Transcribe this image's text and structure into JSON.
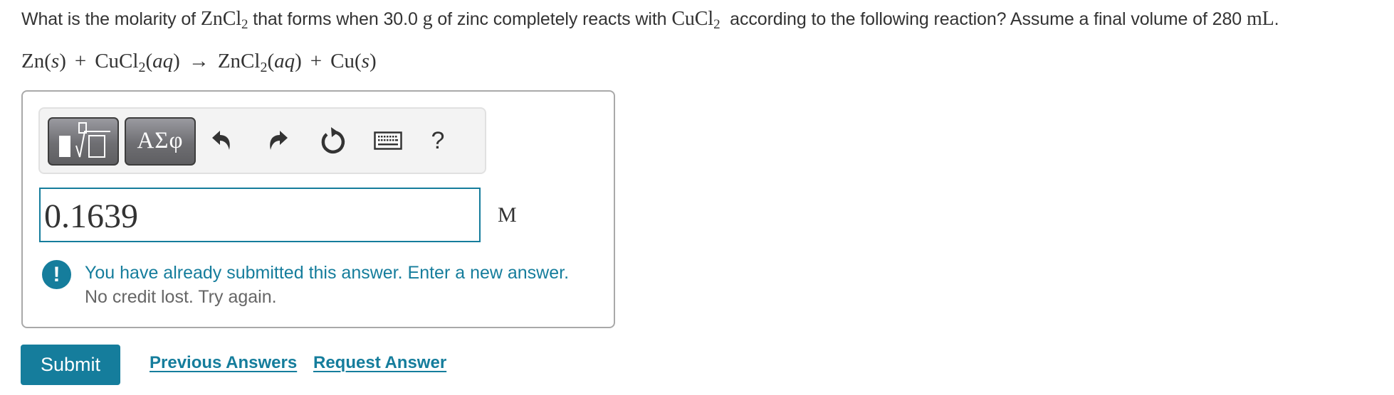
{
  "question": {
    "parts": [
      {
        "type": "text",
        "value": "What is the molarity of "
      },
      {
        "type": "math",
        "base": "ZnCl",
        "sub": "2"
      },
      {
        "type": "text",
        "value": " that forms when 30.0 "
      },
      {
        "type": "math",
        "base": "g",
        "sub": ""
      },
      {
        "type": "text",
        "value": " of zinc completely reacts with "
      },
      {
        "type": "math",
        "base": "CuCl",
        "sub": "2"
      },
      {
        "type": "text",
        "value": "  according to the following reaction? Assume a final volume of 280 "
      },
      {
        "type": "math",
        "base": "mL",
        "sub": ""
      },
      {
        "type": "text",
        "value": "."
      }
    ]
  },
  "equation": {
    "reactant1": {
      "formula": "Zn",
      "sub": "",
      "state": "s"
    },
    "plus1": "+",
    "reactant2": {
      "formula": "CuCl",
      "sub": "2",
      "state": "aq"
    },
    "arrow": "→",
    "product1": {
      "formula": "ZnCl",
      "sub": "2",
      "state": "aq"
    },
    "plus2": "+",
    "product2": {
      "formula": "Cu",
      "sub": "",
      "state": "s"
    }
  },
  "toolbar": {
    "templates_icon": "templates-sqrt-icon",
    "symbols_label": "ΑΣφ",
    "undo_icon": "undo-icon",
    "redo_icon": "redo-icon",
    "reset_icon": "reset-icon",
    "keyboard_icon": "keyboard-icon",
    "help_label": "?"
  },
  "answer": {
    "value": "0.1639",
    "unit": "M"
  },
  "feedback": {
    "icon": "exclamation-icon",
    "icon_glyph": "!",
    "message": "You have already submitted this answer. Enter a new answer.",
    "sub_message": "No credit lost. Try again."
  },
  "actions": {
    "submit_label": "Submit",
    "previous_answers_label": "Previous Answers",
    "request_answer_label": "Request Answer"
  },
  "colors": {
    "accent": "#157d9c",
    "text": "#333333",
    "muted": "#666666",
    "toolbar_bg": "#f3f3f3",
    "border": "#a9a9a9"
  }
}
